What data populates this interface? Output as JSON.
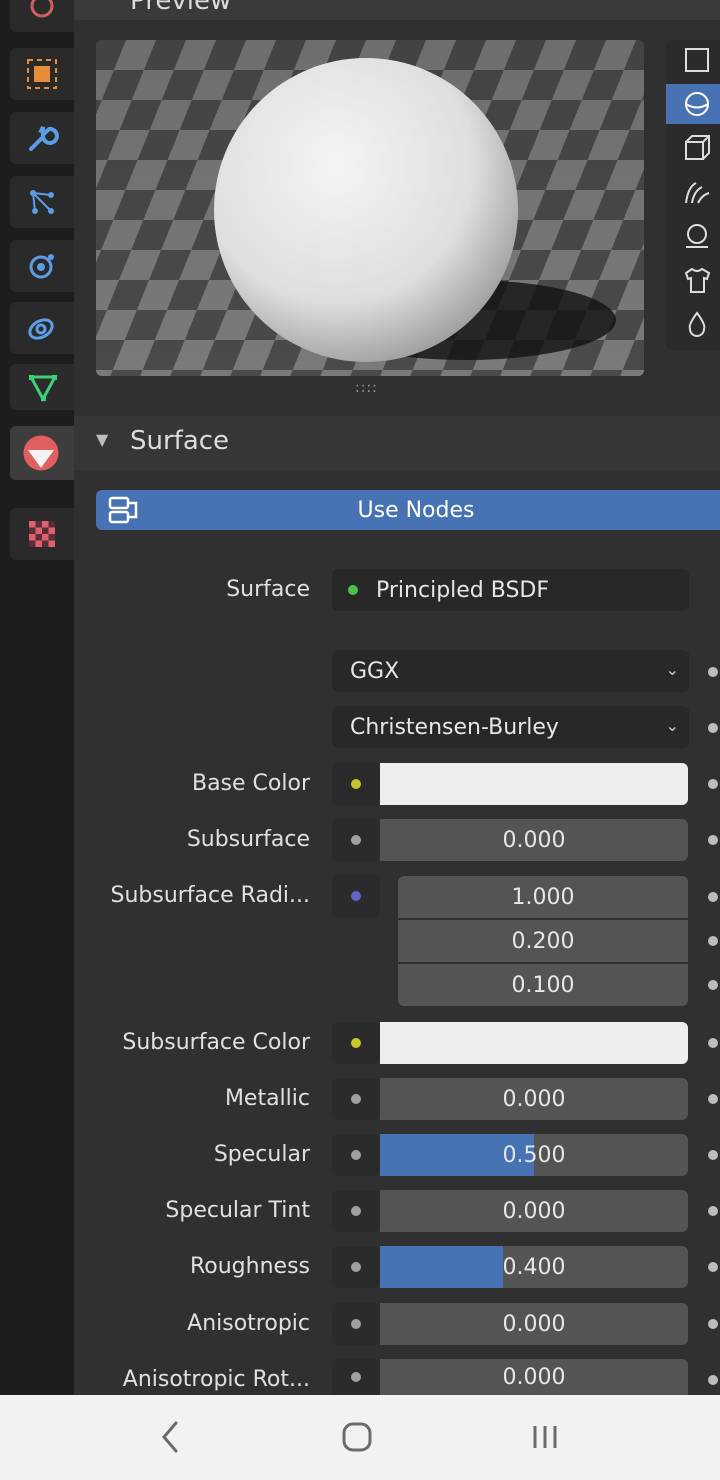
{
  "preview": {
    "title": "Preview",
    "handle": "::::"
  },
  "shape_buttons": [
    "flat-preview-icon",
    "sphere-preview-icon",
    "cube-preview-icon",
    "hair-preview-icon",
    "monkey-preview-icon",
    "cloth-preview-icon",
    "fluid-preview-icon"
  ],
  "surface": {
    "section_title": "Surface",
    "use_nodes_label": "Use Nodes",
    "surface_label": "Surface",
    "surface_value": "Principled BSDF",
    "distribution": "GGX",
    "subsurface_method": "Christensen-Burley"
  },
  "properties": {
    "base_color_label": "Base Color",
    "subsurface_label": "Subsurface",
    "subsurface_value": "0.000",
    "subsurface_radius_label": "Subsurface Radi...",
    "subsurface_radius_values": [
      "1.000",
      "0.200",
      "0.100"
    ],
    "subsurface_color_label": "Subsurface Color",
    "metallic_label": "Metallic",
    "metallic_value": "0.000",
    "specular_label": "Specular",
    "specular_value": "0.500",
    "specular_tint_label": "Specular Tint",
    "specular_tint_value": "0.000",
    "roughness_label": "Roughness",
    "roughness_value": "0.400",
    "anisotropic_label": "Anisotropic",
    "anisotropic_value": "0.000",
    "anisotropic_rot_label": "Anisotropic Rot...",
    "anisotropic_rot_value": "0.000"
  },
  "fills": {
    "specular": 0.5,
    "roughness": 0.4
  },
  "colors": {
    "accent": "#4772b3",
    "socket_shader": "#47c447",
    "socket_color": "#c7c729",
    "socket_float": "#a1a1a1",
    "socket_vector": "#6363c7"
  }
}
